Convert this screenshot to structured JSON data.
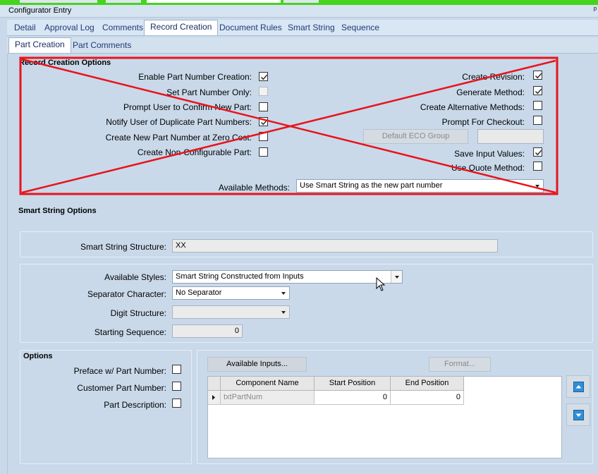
{
  "window": {
    "title": "Configurator Entry",
    "pin": "ᵖ"
  },
  "main_tabs": [
    {
      "label": "Detail"
    },
    {
      "label": "Approval Log"
    },
    {
      "label": "Comments"
    },
    {
      "label": "Record Creation",
      "active": true
    },
    {
      "label": "Document Rules"
    },
    {
      "label": "Smart String"
    },
    {
      "label": "Sequence"
    }
  ],
  "sub_tabs": [
    {
      "label": "Part Creation",
      "active": true
    },
    {
      "label": "Part Comments"
    }
  ],
  "record_creation": {
    "header": "Record Creation Options",
    "left_options": [
      {
        "label": "Enable Part Number Creation:",
        "checked": true,
        "disabled": false
      },
      {
        "label": "Set Part Number Only:",
        "checked": false,
        "disabled": true
      },
      {
        "label": "Prompt User to Confirm New Part:",
        "checked": false,
        "disabled": false
      },
      {
        "label": "Notify User of Duplicate Part Numbers:",
        "checked": true,
        "disabled": false
      },
      {
        "label": "Create New Part Number at Zero Cost:",
        "checked": false,
        "disabled": false
      },
      {
        "label": "Create Non-Configurable Part:",
        "checked": false,
        "disabled": false
      }
    ],
    "right_options": [
      {
        "label": "Create Revision:",
        "checked": true
      },
      {
        "label": "Generate Method:",
        "checked": true
      },
      {
        "label": "Create Alternative Methods:",
        "checked": false
      },
      {
        "label": "Prompt For Checkout:",
        "checked": false
      },
      {
        "label": "Save Input Values:",
        "checked": true
      },
      {
        "label": "Use Quote Method:",
        "checked": false
      }
    ],
    "default_eco_group_label": "Default ECO Group",
    "available_methods_label": "Available Methods:",
    "available_methods_value": "Use Smart String as the new part number"
  },
  "smart_string": {
    "header": "Smart String Options",
    "structure_label": "Smart String Structure:",
    "structure_value": "XX",
    "styles_label": "Available Styles:",
    "styles_value": "Smart String Constructed from Inputs",
    "separator_label": "Separator Character:",
    "separator_value": "No Separator",
    "digit_label": "Digit Structure:",
    "digit_value": "",
    "start_label": "Starting Sequence:",
    "start_value": "0"
  },
  "options": {
    "header": "Options",
    "items": [
      {
        "label": "Preface w/ Part Number:",
        "checked": false
      },
      {
        "label": "Customer Part Number:",
        "checked": false
      },
      {
        "label": "Part Description:",
        "checked": false
      }
    ]
  },
  "inputs": {
    "available_inputs_button": "Available Inputs...",
    "format_button": "Format...",
    "grid_headers": [
      "Component Name",
      "Start Position",
      "End Position"
    ],
    "rows": [
      {
        "component": "txtPartNum",
        "start": "0",
        "end": "0"
      }
    ]
  },
  "colors": {
    "markup_red": "#e8141c",
    "tab_text": "#1e3b78",
    "top_strip": "#46d41f"
  },
  "icons": [
    "move-up-icon",
    "move-down-icon",
    "row-indicator-icon",
    "checkmark-icon",
    "mouse-pointer-icon"
  ]
}
